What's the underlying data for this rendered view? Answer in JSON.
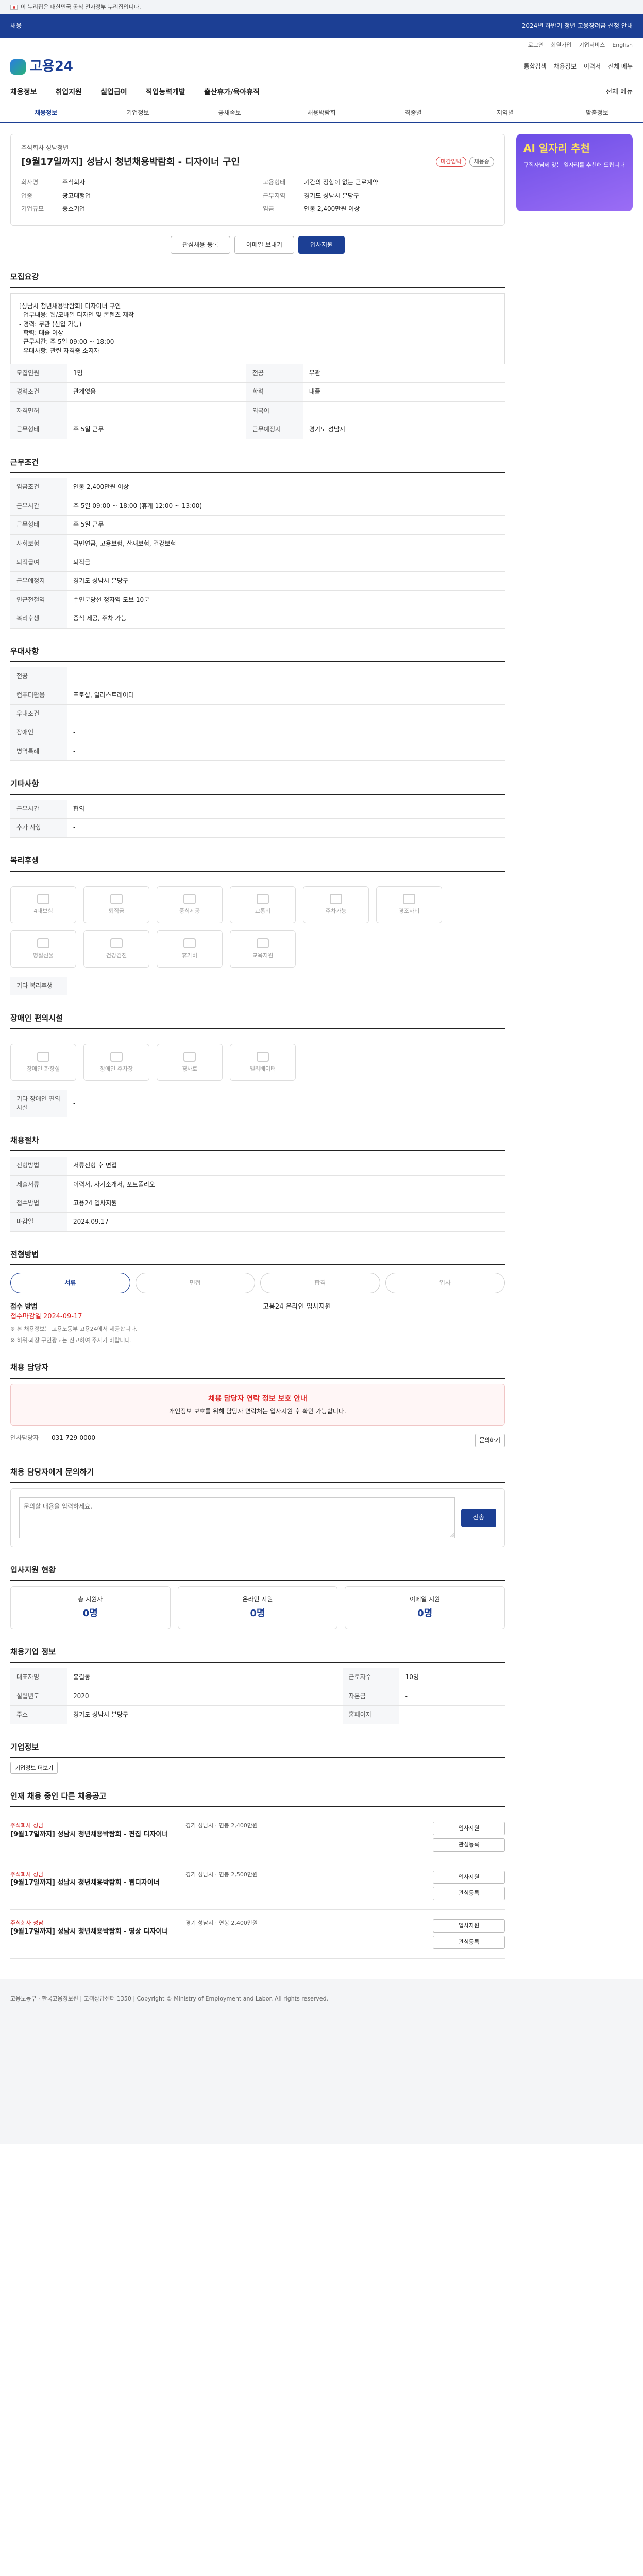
{
  "govbar": {
    "text": "이 누리집은 대한민국 공식 전자정부 누리집입니다."
  },
  "top": {
    "tag": "채용",
    "notice": "2024년 하반기 청년 고용장려금 신청 안내"
  },
  "util": [
    "로그인",
    "회원가입",
    "기업서비스",
    "English"
  ],
  "logo": {
    "text": "고용24"
  },
  "hdr_right": [
    "통합검색",
    "채용정보",
    "이력서",
    "전체 메뉴"
  ],
  "nav": [
    "채용정보",
    "취업지원",
    "실업급여",
    "직업능력개발",
    "출산휴가/육아휴직"
  ],
  "allmenu": "전체 메뉴",
  "subnav": [
    "채용정보",
    "기업정보",
    "공채속보",
    "채용박람회",
    "직종별",
    "지역별",
    "맞춤정보"
  ],
  "side": {
    "title": "AI 일자리 추천",
    "body": "구직자님께 맞는 일자리를 추천해 드립니다"
  },
  "job": {
    "company": "주식회사 성남청년",
    "title": "[9월17일까지] 성남시 청년채용박람회 - 디자이너 구인",
    "tags": [
      "마감임박",
      "채용중"
    ],
    "left": [
      {
        "k": "회사명",
        "v": "주식회사"
      },
      {
        "k": "업종",
        "v": "광고대행업"
      },
      {
        "k": "기업규모",
        "v": "중소기업"
      }
    ],
    "right": [
      {
        "k": "고용형태",
        "v": "기간의 정함이 없는 근로계약"
      },
      {
        "k": "근무지역",
        "v": "경기도 성남시 분당구"
      },
      {
        "k": "임금",
        "v": "연봉 2,400만원 이상"
      }
    ],
    "buttons": [
      "관심채용 등록",
      "이메일 보내기",
      "입사지원"
    ]
  },
  "recruit": {
    "h": "모집요강",
    "desc": "[성남시 청년채용박람회] 디자이너 구인\n- 업무내용: 웹/모바일 디자인 및 콘텐츠 제작\n- 경력: 무관 (신입 가능)\n- 학력: 대졸 이상\n- 근무시간: 주 5일 09:00 ~ 18:00\n- 우대사항: 관련 자격증 소지자",
    "rows": [
      [
        "모집인원",
        "1명",
        "전공",
        "무관"
      ],
      [
        "경력조건",
        "관계없음",
        "학력",
        "대졸"
      ],
      [
        "자격면허",
        "-",
        "외국어",
        "-"
      ],
      [
        "근무형태",
        "주 5일 근무",
        "근무예정지",
        "경기도 성남시"
      ]
    ]
  },
  "cond": {
    "h": "근무조건",
    "rows": [
      [
        "임금조건",
        "연봉 2,400만원 이상"
      ],
      [
        "근무시간",
        "주 5일 09:00 ~ 18:00 (휴게 12:00 ~ 13:00)"
      ],
      [
        "근무형태",
        "주 5일 근무"
      ],
      [
        "사회보험",
        "국민연금, 고용보험, 산재보험, 건강보험"
      ],
      [
        "퇴직급여",
        "퇴직금"
      ],
      [
        "근무예정지",
        "경기도 성남시 분당구"
      ],
      [
        "인근전철역",
        "수인분당선 정자역 도보 10분"
      ],
      [
        "복리후생",
        "중식 제공, 주차 가능"
      ]
    ]
  },
  "prefer": {
    "h": "우대사항",
    "rows": [
      [
        "전공",
        "-"
      ],
      [
        "컴퓨터활용",
        "포토샵, 일러스트레이터"
      ],
      [
        "우대조건",
        "-"
      ],
      [
        "장애인",
        "-"
      ],
      [
        "병역특례",
        "-"
      ]
    ]
  },
  "extra": {
    "h": "기타사항",
    "rows": [
      [
        "근무시간",
        "협의"
      ],
      [
        "추가 사항",
        "-"
      ]
    ]
  },
  "welfare": {
    "h": "복리후생",
    "items": [
      "4대보험",
      "퇴직금",
      "중식제공",
      "교통비",
      "주차가능",
      "경조사비",
      "명절선물",
      "건강검진",
      "휴가비",
      "교육지원"
    ],
    "other_label": "기타 복리후생",
    "other": "-"
  },
  "disability": {
    "h": "장애인 편의시설",
    "items": [
      "장애인 화장실",
      "장애인 주차장",
      "경사로",
      "엘리베이터"
    ],
    "other_label": "기타 장애인 편의시설",
    "other": "-"
  },
  "hr": {
    "h": "채용절차",
    "rows": [
      [
        "전형방법",
        "서류전형 후 면접"
      ],
      [
        "제출서류",
        "이력서, 자기소개서, 포트폴리오"
      ],
      [
        "접수방법",
        "고용24 입사지원"
      ],
      [
        "마감일",
        "2024.09.17"
      ]
    ]
  },
  "steps": {
    "h": "전형방법",
    "items": [
      "서류",
      "면접",
      "합격",
      "입사"
    ]
  },
  "apply": {
    "h": "접수 방법",
    "deadline": "접수마감일 2024-09-17",
    "method": "고용24 온라인 입사지원",
    "notes": [
      "※ 본 채용정보는 고용노동부 고용24에서 제공합니다.",
      "※ 허위·과장 구인광고는 신고하여 주시기 바랍니다."
    ]
  },
  "contact": {
    "h": "채용 담당자",
    "alert_title": "채용 담당자 연락 정보 보호 안내",
    "alert_body": "개인정보 보호를 위해 담당자 연락처는 입사지원 후 확인 가능합니다.",
    "person": "인사담당자",
    "phone": "031-729-0000",
    "btn": "문의하기"
  },
  "inquiry": {
    "h": "채용 담당자에게 문의하기",
    "placeholder": "문의할 내용을 입력하세요.",
    "submit": "전송"
  },
  "stats": {
    "h": "입사지원 현황",
    "cards": [
      {
        "label": "총 지원자",
        "n": "0명"
      },
      {
        "label": "온라인 지원",
        "n": "0명"
      },
      {
        "label": "이메일 지원",
        "n": "0명"
      }
    ]
  },
  "info": {
    "h": "채용기업 정보",
    "rows": [
      [
        "대표자명",
        "홍길동",
        "근로자수",
        "10명"
      ],
      [
        "설립년도",
        "2020",
        "자본금",
        "-"
      ],
      [
        "주소",
        "경기도 성남시 분당구",
        "홈페이지",
        "-"
      ]
    ]
  },
  "company": {
    "h": "기업정보",
    "btn": "기업정보 더보기"
  },
  "similar": {
    "h": "인재 채용 중인 다른 채용공고",
    "jobs": [
      {
        "comp": "주식회사 성남",
        "title": "[9월17일까지] 성남시 청년채용박람회 - 편집 디자이너",
        "meta": "경기 성남시 · 연봉 2,400만원",
        "b1": "입사지원",
        "b2": "관심등록"
      },
      {
        "comp": "주식회사 성남",
        "title": "[9월17일까지] 성남시 청년채용박람회 - 웹디자이너",
        "meta": "경기 성남시 · 연봉 2,500만원",
        "b1": "입사지원",
        "b2": "관심등록"
      },
      {
        "comp": "주식회사 성남",
        "title": "[9월17일까지] 성남시 청년채용박람회 - 영상 디자이너",
        "meta": "경기 성남시 · 연봉 2,400만원",
        "b1": "입사지원",
        "b2": "관심등록"
      }
    ]
  },
  "footer": {
    "text": "고용노동부 · 한국고용정보원 | 고객상담센터 1350 | Copyright © Ministry of Employment and Labor. All rights reserved."
  }
}
